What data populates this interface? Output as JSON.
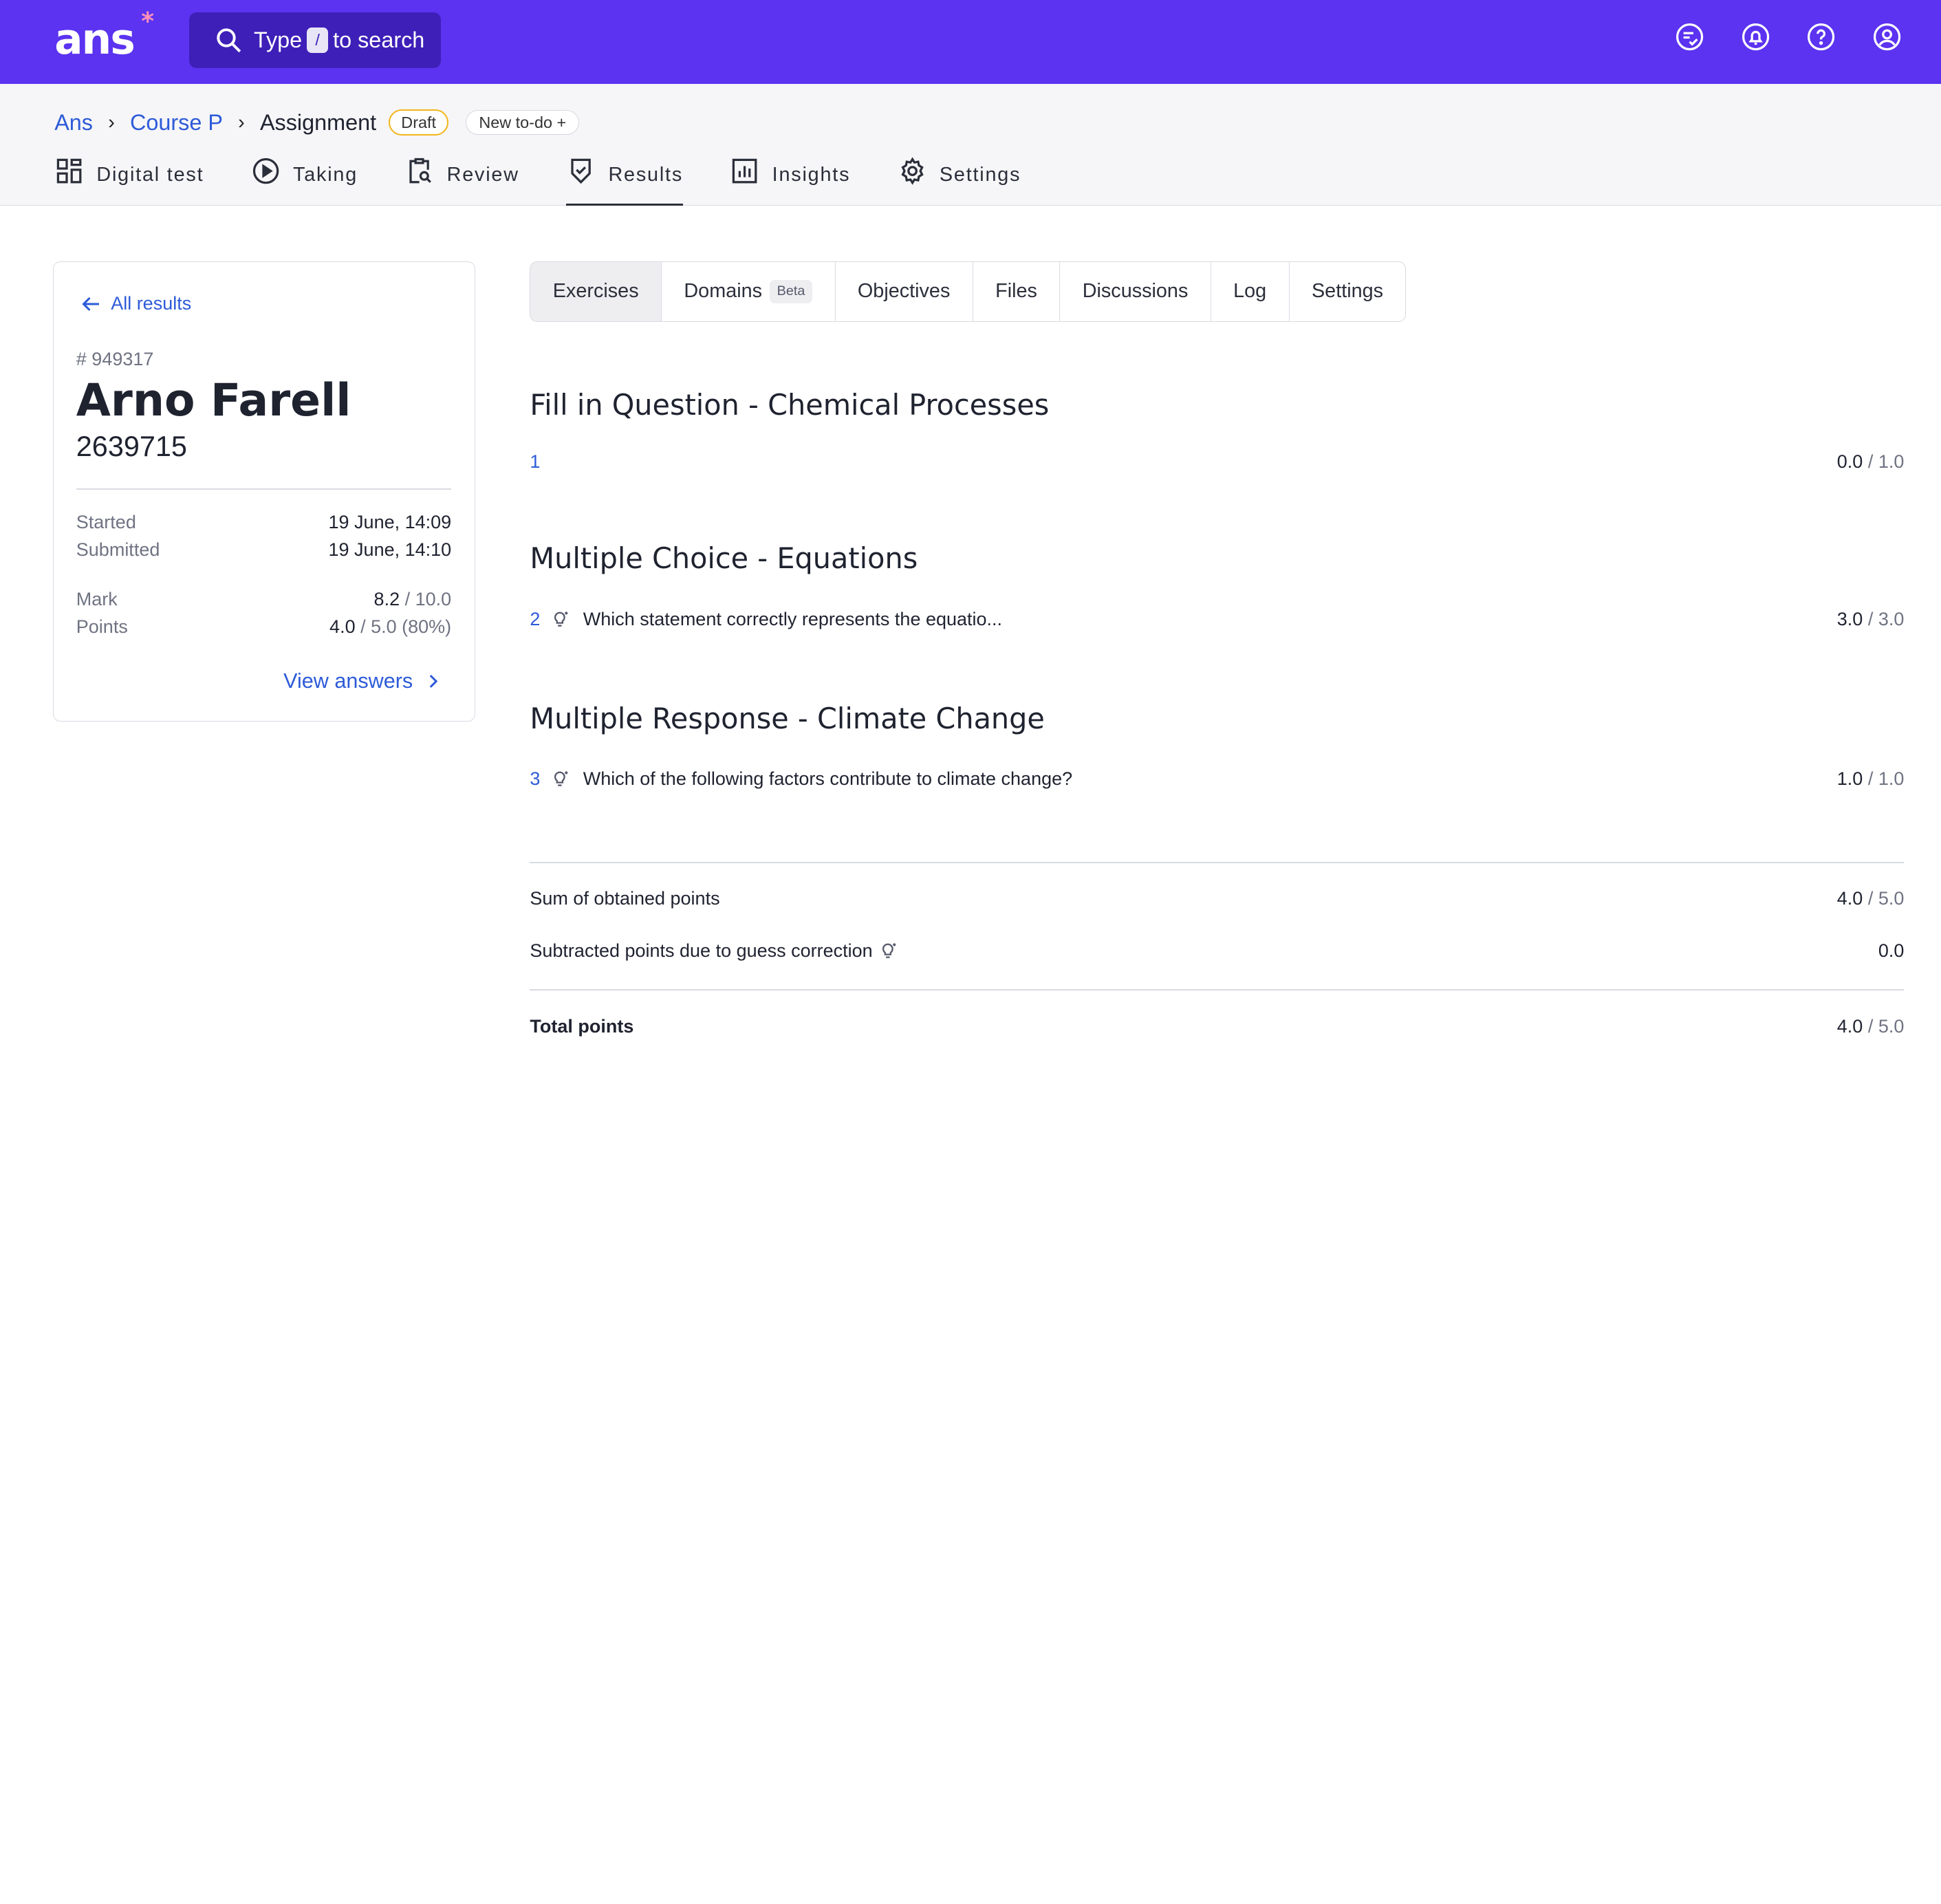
{
  "topbar": {
    "logo": "ans",
    "search_prefix": "Type",
    "search_key": "/",
    "search_suffix": "to search",
    "accent_color": "#5b33f0"
  },
  "breadcrumb": {
    "items": [
      "Ans",
      "Course P",
      "Assignment"
    ],
    "status_badge": "Draft",
    "new_todo": "New to-do"
  },
  "tabs": [
    {
      "label": "Digital test",
      "icon": "grid-icon"
    },
    {
      "label": "Taking",
      "icon": "play-circle-icon"
    },
    {
      "label": "Review",
      "icon": "clipboard-search-icon"
    },
    {
      "label": "Results",
      "icon": "shield-check-icon",
      "active": true
    },
    {
      "label": "Insights",
      "icon": "chart-icon"
    },
    {
      "label": "Settings",
      "icon": "gear-icon"
    }
  ],
  "student": {
    "back_label": "All results",
    "result_id": "# 949317",
    "name": "Arno Farell",
    "student_number": "2639715",
    "started_label": "Started",
    "started_value": "19 June, 14:09",
    "submitted_label": "Submitted",
    "submitted_value": "19 June, 14:10",
    "mark_label": "Mark",
    "mark_value": "8.2",
    "mark_total": "/ 10.0",
    "points_label": "Points",
    "points_value": "4.0",
    "points_total": "/ 5.0 (80%)",
    "view_answers": "View answers"
  },
  "segments": [
    {
      "label": "Exercises",
      "active": true
    },
    {
      "label": "Domains",
      "badge": "Beta"
    },
    {
      "label": "Objectives"
    },
    {
      "label": "Files"
    },
    {
      "label": "Discussions"
    },
    {
      "label": "Log"
    },
    {
      "label": "Settings"
    }
  ],
  "exercises": [
    {
      "title": "Fill in Question - Chemical Processes",
      "num": "1",
      "question": "",
      "score": "0.0",
      "max": "/ 1.0",
      "guess": false
    },
    {
      "title": "Multiple Choice - Equations",
      "num": "2",
      "question": "Which statement correctly represents the equatio...",
      "score": "3.0",
      "max": "/ 3.0",
      "guess": true
    },
    {
      "title": "Multiple Response - Climate Change",
      "num": "3",
      "question": "Which of the following factors contribute to climate change?",
      "score": "1.0",
      "max": "/ 1.0",
      "guess": true
    }
  ],
  "summary": {
    "sum_label": "Sum of obtained points",
    "sum_value": "4.0",
    "sum_max": "/ 5.0",
    "guess_label": "Subtracted points due to guess correction",
    "guess_value": "0.0",
    "total_label": "Total points",
    "total_value": "4.0",
    "total_max": "/ 5.0"
  }
}
